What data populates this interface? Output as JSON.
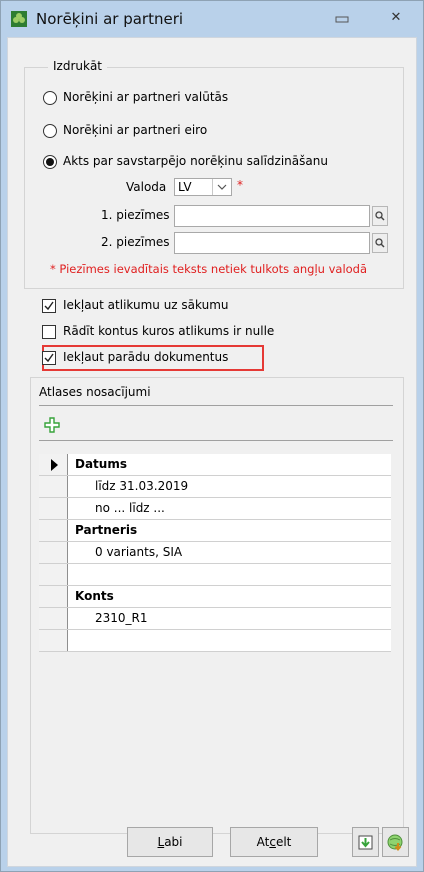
{
  "window": {
    "title": "Norēķini ar partneri",
    "accent": "#b9d1ea"
  },
  "print_group": {
    "title": "Izdrukāt",
    "options": [
      {
        "label": "Norēķini ar partneri valūtās",
        "selected": false
      },
      {
        "label": "Norēķini ar partneri eiro",
        "selected": false
      },
      {
        "label": "Akts par savstarpējo norēķinu salīdzināšanu",
        "selected": true
      }
    ],
    "language_label": "Valoda",
    "language_value": "LV",
    "required_mark": "*",
    "note1_label": "1. piezīmes",
    "note1_value": "",
    "note2_label": "2. piezīmes",
    "note2_value": "",
    "notice": "* Piezīmes ievadītais teksts netiek tulkots angļu valodā"
  },
  "checkboxes": [
    {
      "label": "Iekļaut atlikumu uz sākumu",
      "checked": true
    },
    {
      "label": "Rādīt kontus kuros atlikums ir nulle",
      "checked": false
    },
    {
      "label": "Iekļaut parādu dokumentus",
      "checked": true
    }
  ],
  "filters": {
    "title": "Atlases nosacījumi",
    "rows": [
      {
        "text": "Datums",
        "type": "header"
      },
      {
        "text": "līdz 31.03.2019",
        "type": "value"
      },
      {
        "text": "no ... līdz ...",
        "type": "value"
      },
      {
        "text": "Partneris",
        "type": "header"
      },
      {
        "text": "0 variants, SIA",
        "type": "value"
      },
      {
        "text": "",
        "type": "empty"
      },
      {
        "text": "Konts",
        "type": "header"
      },
      {
        "text": "2310_R1",
        "type": "value"
      },
      {
        "text": "",
        "type": "empty"
      }
    ]
  },
  "buttons": {
    "ok_rest": "abi",
    "ok_access": "L",
    "cancel_pre": "At",
    "cancel_access": "c",
    "cancel_post": "elt"
  },
  "colors": {
    "highlight": "#e53935",
    "required": "#e02020",
    "icon_green": "#37a33a"
  }
}
